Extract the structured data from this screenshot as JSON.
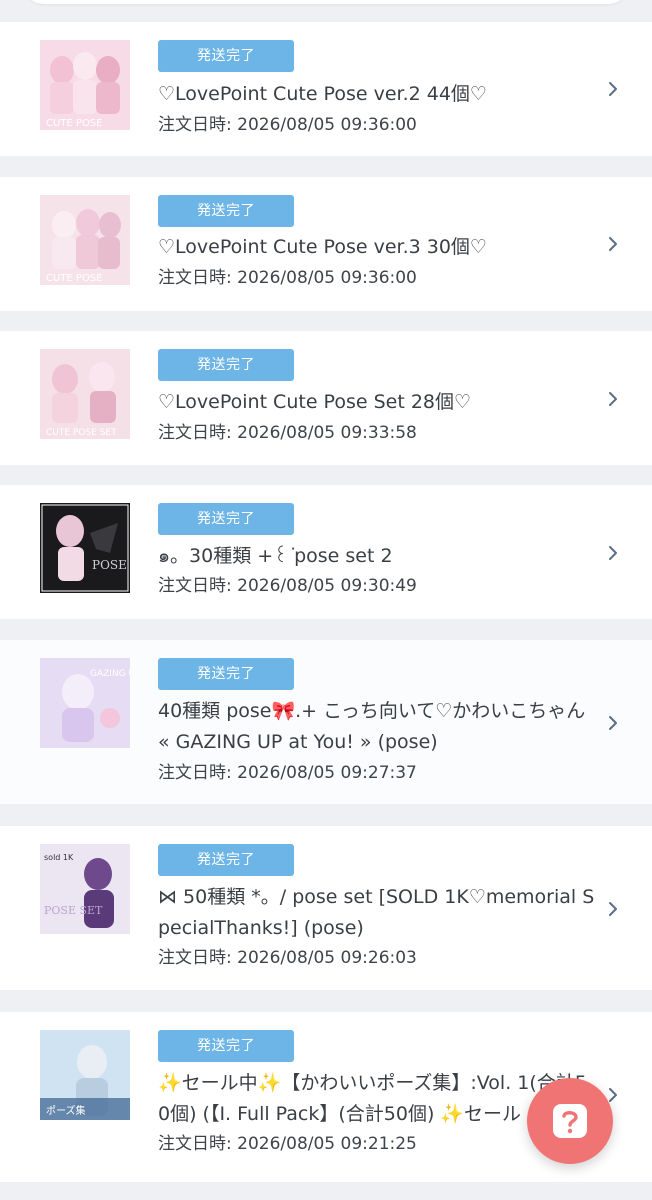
{
  "orders": [
    {
      "status": "発送完了",
      "title": "♡LovePoint Cute Pose ver.2 44個♡",
      "date_label": "注文日時: 2026/08/05 09:36:00"
    },
    {
      "status": "発送完了",
      "title": "♡LovePoint Cute Pose ver.3 30個♡",
      "date_label": "注文日時: 2026/08/05 09:36:00"
    },
    {
      "status": "発送完了",
      "title": "♡LovePoint Cute Pose Set 28個♡",
      "date_label": "注文日時: 2026/08/05 09:33:58"
    },
    {
      "status": "発送完了",
      "title": "๑。30種類 +꒰ ͘pose set 2",
      "date_label": "注文日時: 2026/08/05 09:30:49"
    },
    {
      "status": "発送完了",
      "title": "40種類 pose🎀.+ こっち向いて♡かわいこちゃん « GAZING UP at You! » (pose)",
      "date_label": "注文日時: 2026/08/05 09:27:37"
    },
    {
      "status": "発送完了",
      "title": "⋈ 50種類 *。/ pose set [SOLD 1K♡memorial SpecialThanks!] (pose)",
      "date_label": "注文日時: 2026/08/05 09:26:03"
    },
    {
      "status": "発送完了",
      "title": "✨セール中✨【かわいいポーズ集】:Vol. 1(合計50個) (【I. Full Pack】(合計50個) ✨セール",
      "date_label": "注文日時: 2026/08/05 09:21:25"
    }
  ],
  "thumbnails": [
    {
      "icon": "product-thumbnail-pink-icon",
      "caption": "CUTE POSE"
    },
    {
      "icon": "product-thumbnail-pink-icon",
      "caption": "CUTE POSE"
    },
    {
      "icon": "product-thumbnail-pink-icon",
      "caption": "CUTE POSE SET"
    },
    {
      "icon": "product-thumbnail-dark-icon",
      "caption": "POSE"
    },
    {
      "icon": "product-thumbnail-lavender-icon",
      "caption": "GAZING UP"
    },
    {
      "icon": "product-thumbnail-purple-icon",
      "caption": "POSE SET"
    },
    {
      "icon": "product-thumbnail-blue-icon",
      "caption": "ポーズ集"
    }
  ],
  "help_button": {
    "icon": "help-question-icon",
    "color": "#f17474"
  },
  "colors": {
    "badge": "#6cb5e6",
    "chevron": "#5a6e85",
    "separator": "#eef0f3"
  }
}
